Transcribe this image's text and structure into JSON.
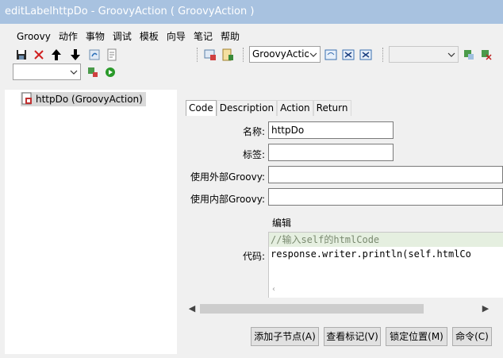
{
  "window": {
    "title": "editLabelhttpDo - GroovyAction ( GroovyAction )"
  },
  "menu": [
    "Groovy",
    "动作",
    "事物",
    "调试",
    "模板",
    "向导",
    "笔记",
    "帮助"
  ],
  "toolbar": {
    "class_combo_value": "GroovyActio",
    "empty_combo_value": "",
    "icons": [
      "save-icon",
      "delete-icon",
      "arrow-up-icon",
      "arrow-down-icon",
      "refresh-icon",
      "document-icon",
      "component-icon",
      "note-icon",
      "action-icon-1",
      "action-icon-2",
      "action-icon-3",
      "puzzle-icon-1",
      "puzzle-icon-2",
      "run-icon"
    ]
  },
  "toolbar2": {
    "combo_value": ""
  },
  "tree": {
    "node_label": "httpDo (GroovyAction)"
  },
  "tabs": [
    "Code",
    "Description",
    "Action",
    "Return"
  ],
  "form": {
    "name_label": "名称:",
    "name_value": "httpDo",
    "tag_label": "标签:",
    "tag_value": "",
    "external_label": "使用外部Groovy:",
    "external_value": "",
    "internal_label": "使用内部Groovy:",
    "internal_value": "",
    "edit_label": "编辑",
    "code_label": "代码:",
    "code_lines": [
      "//输入self的htmlCode",
      "response.writer.println(self.htmlCo"
    ]
  },
  "buttons": {
    "add_child": "添加子节点(A)",
    "view_tag": "查看标记(V)",
    "lock_position": "锁定位置(M)",
    "command": "命令(C)"
  },
  "colors": {
    "titlebar": "#a8c2e0",
    "comment_bg": "#e5efe0"
  }
}
